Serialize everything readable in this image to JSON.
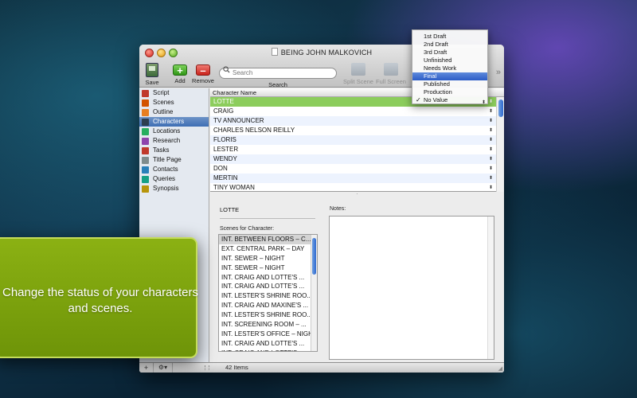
{
  "window": {
    "title": "BEING JOHN MALKOVICH"
  },
  "toolbar": {
    "save_label": "Save",
    "add_label": "Add",
    "remove_label": "Remove",
    "search_placeholder": "Search",
    "search_label": "Search",
    "split_screen_label": "Split Scene",
    "full_screen_label": "Full Screen",
    "overflow_glyph": "»"
  },
  "sidebar": {
    "items": [
      {
        "label": "Script",
        "icon": "script-icon",
        "color": "#c0392b"
      },
      {
        "label": "Scenes",
        "icon": "scenes-icon",
        "color": "#d35400"
      },
      {
        "label": "Outline",
        "icon": "outline-icon",
        "color": "#e67e22"
      },
      {
        "label": "Characters",
        "icon": "characters-icon",
        "color": "#2c3e50"
      },
      {
        "label": "Locations",
        "icon": "locations-icon",
        "color": "#27ae60"
      },
      {
        "label": "Research",
        "icon": "research-icon",
        "color": "#8e44ad"
      },
      {
        "label": "Tasks",
        "icon": "tasks-icon",
        "color": "#c0392b"
      },
      {
        "label": "Title Page",
        "icon": "title-page-icon",
        "color": "#7f8c8d"
      },
      {
        "label": "Contacts",
        "icon": "contacts-icon",
        "color": "#2980b9"
      },
      {
        "label": "Queries",
        "icon": "queries-icon",
        "color": "#16a085"
      },
      {
        "label": "Synopsis",
        "icon": "synopsis-icon",
        "color": "#b7950b"
      }
    ],
    "selected": "Characters"
  },
  "character_list": {
    "column_header": "Character Name",
    "rows": [
      "LOTTE",
      "CRAIG",
      "TV ANNOUNCER",
      "CHARLES NELSON REILLY",
      "FLORIS",
      "LESTER",
      "WENDY",
      "DON",
      "MERTIN",
      "TINY WOMAN"
    ],
    "selected": "LOTTE"
  },
  "status_menu": {
    "items": [
      "1st Draft",
      "2nd Draft",
      "3rd Draft",
      "Unfinished",
      "Needs Work",
      "Final",
      "Published",
      "Production",
      "No Value"
    ],
    "highlighted": "Final",
    "checked": "No Value",
    "check_glyph": "✓"
  },
  "detail": {
    "character_name": "LOTTE",
    "scenes_label": "Scenes for Character:",
    "notes_label": "Notes:",
    "scenes": [
      "INT. BETWEEN FLOORS – C...",
      "EXT. CENTRAL PARK – DAY",
      "INT. SEWER – NIGHT",
      "INT. SEWER – NIGHT",
      "INT. CRAIG AND LOTTE'S ...",
      "INT. CRAIG AND LOTTE'S ...",
      "INT. LESTER'S SHRINE ROO...",
      "INT. CRAIG AND MAXINE'S ...",
      "INT. LESTER'S SHRINE ROO...",
      "INT. SCREENING ROOM – ...",
      "INT. LESTER'S OFFICE – NIGHT",
      "INT. CRAIG AND LOTTE'S ...",
      "INT. CRAIG AND LOTTE'S ..."
    ],
    "selected_scene_index": 0
  },
  "bottom_bar": {
    "add_glyph": "+",
    "gear_glyph": "⚙▾",
    "item_count": "42 Items"
  },
  "callout": {
    "text": "Change the status of your characters and scenes.",
    "color": "#8bb113"
  }
}
